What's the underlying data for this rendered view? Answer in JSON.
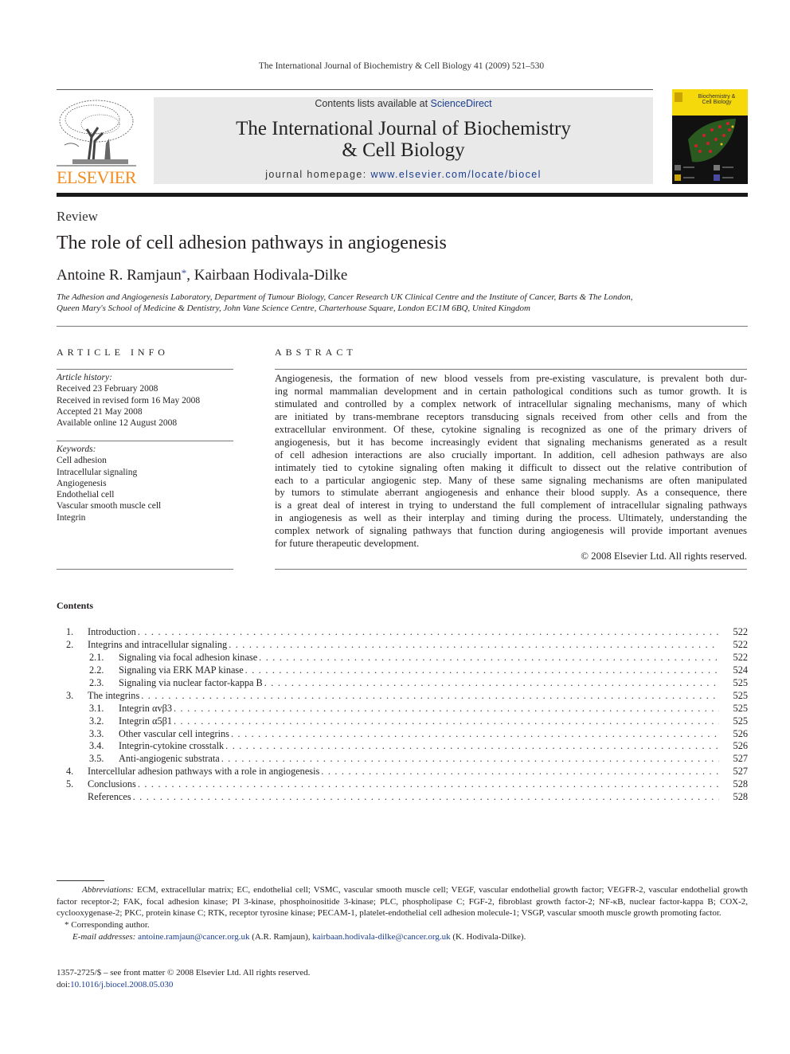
{
  "running_head": "The International Journal of Biochemistry & Cell Biology 41 (2009) 521–530",
  "publisher": {
    "logo_text": "ELSEVIER",
    "logo_icon": "elsevier-tree-logo"
  },
  "banner": {
    "contents_prefix": "Contents lists available at ",
    "contents_link": "ScienceDirect",
    "journal_title_line1": "The International Journal of Biochemistry",
    "journal_title_line2": "& Cell Biology",
    "homepage_prefix": "journal homepage: ",
    "homepage_url": "www.elsevier.com/locate/biocel"
  },
  "cover": {
    "title_line1": "Biochemistry &",
    "title_line2": "Cell Biology",
    "colors": {
      "band": "#f5d90a",
      "background": "#111111"
    }
  },
  "article": {
    "type": "Review",
    "title": "The role of cell adhesion pathways in angiogenesis",
    "author1": "Antoine R. Ramjaun",
    "author1_mark": "*",
    "author_sep": ", ",
    "author2": "Kairbaan Hodivala-Dilke",
    "affiliation_line1": "The Adhesion and Angiogenesis Laboratory, Department of Tumour Biology, Cancer Research UK Clinical Centre and the Institute of Cancer, Barts & The London,",
    "affiliation_line2": "Queen Mary's School of Medicine & Dentistry, John Vane Science Centre, Charterhouse Square, London EC1M 6BQ, United Kingdom"
  },
  "article_info": {
    "heading": "ARTICLE INFO",
    "history_label": "Article history:",
    "history": [
      "Received 23 February 2008",
      "Received in revised form 16 May 2008",
      "Accepted 21 May 2008",
      "Available online 12 August 2008"
    ],
    "keywords_label": "Keywords:",
    "keywords": [
      "Cell adhesion",
      "Intracellular signaling",
      "Angiogenesis",
      "Endothelial cell",
      "Vascular smooth muscle cell",
      "Integrin"
    ]
  },
  "abstract": {
    "heading": "ABSTRACT",
    "lines": [
      "Angiogenesis, the formation of new blood vessels from pre-existing vasculature, is prevalent both dur-",
      "ing normal mammalian development and in certain pathological conditions such as tumor growth. It is",
      "stimulated and controlled by a complex network of intracellular signaling mechanisms, many of which",
      "are initiated by trans-membrane receptors transducing signals received from other cells and from the",
      "extracellular environment. Of these, cytokine signaling is recognized as one of the primary drivers of",
      "angiogenesis, but it has become increasingly evident that signaling mechanisms generated as a result",
      "of cell adhesion interactions are also crucially important. In addition, cell adhesion pathways are also",
      "intimately tied to cytokine signaling often making it difficult to dissect out the relative contribution of",
      "each to a particular angiogenic step. Many of these same signaling mechanisms are often manipulated",
      "by tumors to stimulate aberrant angiogenesis and enhance their blood supply. As a consequence, there",
      "is a great deal of interest in trying to understand the full complement of intracellular signaling pathways",
      "in angiogenesis as well as their interplay and timing during the process. Ultimately, understanding the",
      "complex network of signaling pathways that function during angiogenesis will provide important avenues",
      "for future therapeutic development."
    ],
    "copyright": "© 2008 Elsevier Ltd. All rights reserved."
  },
  "contents": {
    "heading": "Contents",
    "items": [
      {
        "num": "1.",
        "label": "Introduction",
        "page": "522",
        "level": 1
      },
      {
        "num": "2.",
        "label": "Integrins and intracellular signaling",
        "page": "522",
        "level": 1
      },
      {
        "num": "2.1.",
        "label": "Signaling via focal adhesion kinase",
        "page": "522",
        "level": 2
      },
      {
        "num": "2.2.",
        "label": "Signaling via ERK MAP kinase",
        "page": "524",
        "level": 2
      },
      {
        "num": "2.3.",
        "label": "Signaling via nuclear factor-kappa B",
        "page": "525",
        "level": 2
      },
      {
        "num": "3.",
        "label": "The integrins",
        "page": "525",
        "level": 1
      },
      {
        "num": "3.1.",
        "label": "Integrin αvβ3",
        "page": "525",
        "level": 2
      },
      {
        "num": "3.2.",
        "label": "Integrin α5β1",
        "page": "525",
        "level": 2
      },
      {
        "num": "3.3.",
        "label": "Other vascular cell integrins",
        "page": "526",
        "level": 2
      },
      {
        "num": "3.4.",
        "label": "Integrin-cytokine crosstalk",
        "page": "526",
        "level": 2
      },
      {
        "num": "3.5.",
        "label": "Anti-angiogenic substrata",
        "page": "527",
        "level": 2
      },
      {
        "num": "4.",
        "label": "Intercellular adhesion pathways with a role in angiogenesis",
        "page": "527",
        "level": 1
      },
      {
        "num": "5.",
        "label": "Conclusions",
        "page": "528",
        "level": 1
      },
      {
        "num": "",
        "label": "References",
        "page": "528",
        "level": 1
      }
    ]
  },
  "footnotes": {
    "abbrev_label": "Abbreviations:",
    "abbrev_text": "ECM, extracellular matrix; EC, endothelial cell; VSMC, vascular smooth muscle cell; VEGF, vascular endothelial growth factor; VEGFR-2, vascular endothelial growth factor receptor-2; FAK, focal adhesion kinase; PI 3-kinase, phosphoinositide 3-kinase; PLC, phospholipase C; FGF-2, fibroblast growth factor-2; NF-κB, nuclear factor-kappa B; COX-2, cyclooxygenase-2; PKC, protein kinase C; RTK, receptor tyrosine kinase; PECAM-1, platelet-endothelial cell adhesion molecule-1; VSGP, vascular smooth muscle growth promoting factor.",
    "corresponding_mark": "*",
    "corresponding_text": "Corresponding author.",
    "email_label": "E-mail addresses:",
    "email1": "antoine.ramjaun@cancer.org.uk",
    "email1_owner": " (A.R. Ramjaun), ",
    "email2": "kairbaan.hodivala-dilke@cancer.org.uk",
    "email2_owner": " (K. Hodivala-Dilke)."
  },
  "bottom": {
    "issn_line": "1357-2725/$ – see front matter © 2008 Elsevier Ltd. All rights reserved.",
    "doi_prefix": "doi:",
    "doi": "10.1016/j.biocel.2008.05.030"
  },
  "colors": {
    "link": "#1a3d8f",
    "elsevier_orange": "#f28c1f",
    "banner_bg": "#e9e9e9"
  }
}
